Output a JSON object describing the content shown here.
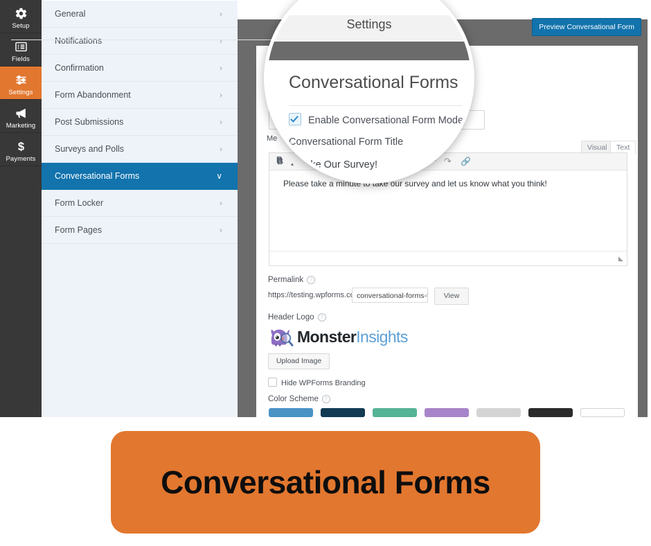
{
  "rail": {
    "items": [
      {
        "label": "Setup",
        "icon": "gear-icon",
        "active": false
      },
      {
        "label": "Fields",
        "icon": "list-icon",
        "active": false
      },
      {
        "label": "Settings",
        "icon": "sliders-icon",
        "active": true
      },
      {
        "label": "Marketing",
        "icon": "megaphone-icon",
        "active": false
      },
      {
        "label": "Payments",
        "icon": "dollar-icon",
        "active": false
      }
    ]
  },
  "settings_nav": {
    "items": [
      {
        "label": "General",
        "chevron": "›"
      },
      {
        "label": "Notifications",
        "chevron": "›"
      },
      {
        "label": "Confirmation",
        "chevron": "›"
      },
      {
        "label": "Form Abandonment",
        "chevron": "›"
      },
      {
        "label": "Post Submissions",
        "chevron": "›"
      },
      {
        "label": "Surveys and Polls",
        "chevron": "›"
      },
      {
        "label": "Conversational Forms",
        "chevron": "∨"
      },
      {
        "label": "Form Locker",
        "chevron": "›"
      },
      {
        "label": "Form Pages",
        "chevron": "›"
      }
    ],
    "active_index": 6
  },
  "content": {
    "preview_button": "Preview Conversational Form",
    "peek_heading": "C",
    "peek_message_label": "Me",
    "title_input_value": "",
    "editor_tabs": {
      "visual": "Visual",
      "text": "Text"
    },
    "editor_toolbar": {
      "bold": "B",
      "caret": "▴",
      "undo": "↶",
      "redo": "↷",
      "link": "🔗"
    },
    "editor_body": "Please take a minute to take our survey and let us know what you think!",
    "permalink": {
      "label": "Permalink",
      "base_url": "https://testing.wpforms.com/",
      "slug_value": "conversational-forms-t",
      "view_button": "View"
    },
    "header_logo": {
      "label": "Header Logo",
      "brand_first": "Monster",
      "brand_second": "Insights",
      "upload_button": "Upload Image"
    },
    "hide_branding": {
      "label": "Hide WPForms Branding",
      "checked": false
    },
    "color_scheme": {
      "label": "Color Scheme",
      "swatches": [
        "#4a92c4",
        "#123a52",
        "#55b396",
        "#a784c9",
        "#d4d4d4",
        "#2b2b2b",
        "#ffffff"
      ]
    }
  },
  "magnifier": {
    "header": "Settings",
    "title": "Conversational Forms",
    "checkbox_label": "Enable Conversational Form Mode",
    "checkbox_checked": true,
    "sub_label": "Conversational Form Title",
    "survey_text": "Take Our Survey!"
  },
  "banner": {
    "text": "Conversational Forms",
    "background": "#e2772f"
  }
}
